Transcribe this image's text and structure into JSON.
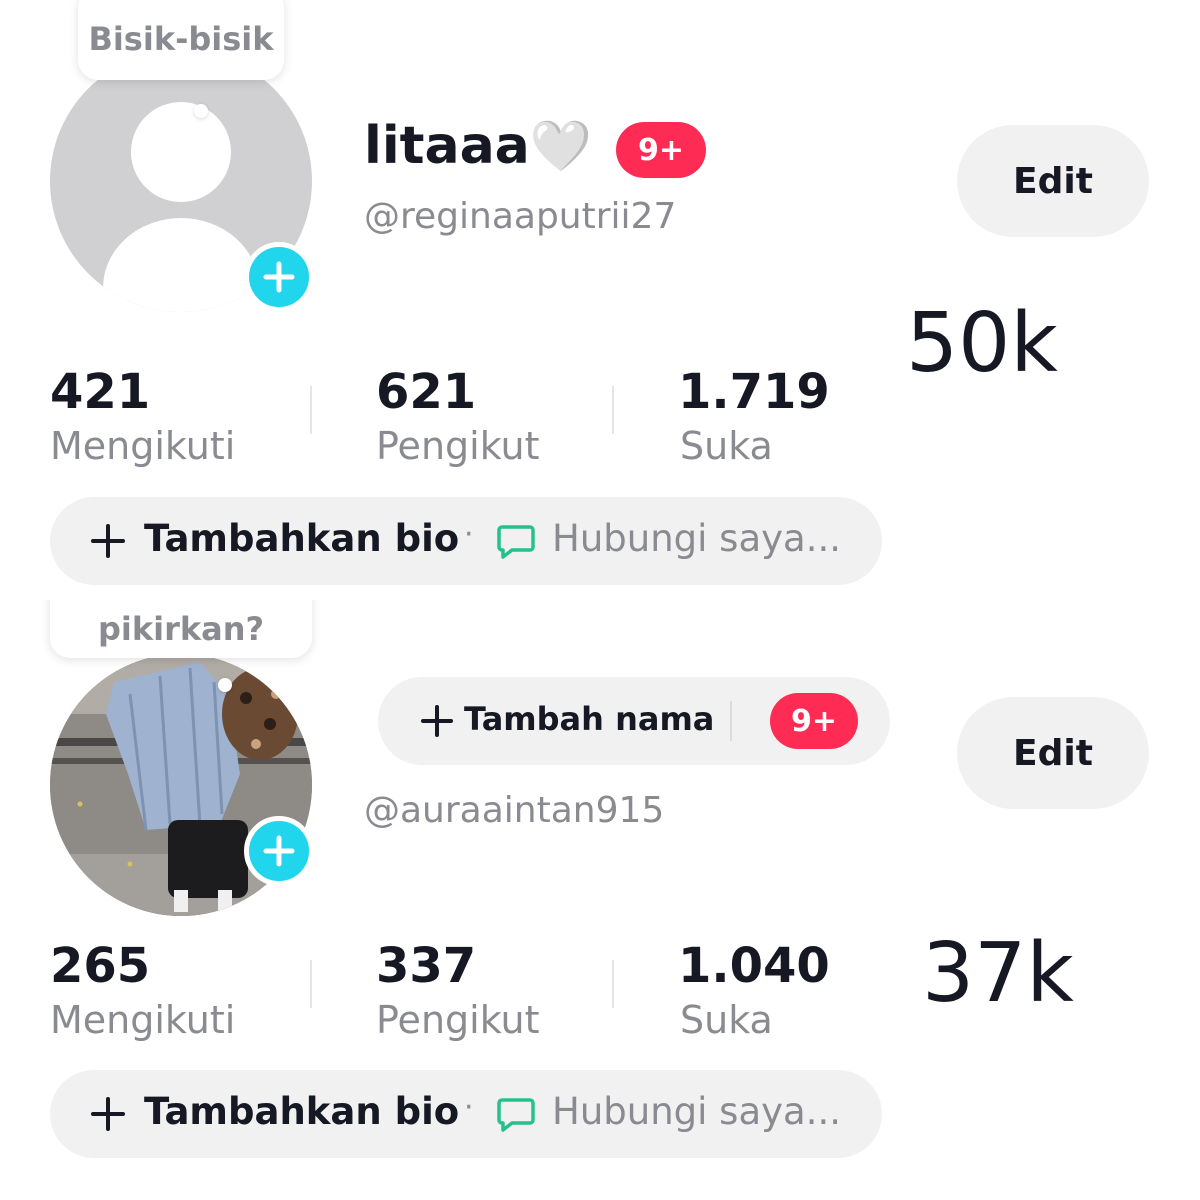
{
  "profile1": {
    "bubble_text": "Bisik-bisik",
    "display_name": "litaaa",
    "name_emoji": "🤍",
    "notification_badge": "9+",
    "username": "@reginaaputrii27",
    "edit_label": "Edit",
    "overlay_count": "50k",
    "stats": [
      {
        "value": "421",
        "label": "Mengikuti"
      },
      {
        "value": "621",
        "label": "Pengikut"
      },
      {
        "value": "1.719",
        "label": "Suka"
      }
    ],
    "bio_add_label": "Tambahkan bio",
    "separator": "·",
    "contact_label": "Hubungi saya..."
  },
  "profile2": {
    "bubble_text": "pikirkan?",
    "add_name_label": "Tambah nama",
    "notification_badge": "9+",
    "username": "@auraaintan915",
    "edit_label": "Edit",
    "overlay_count": "37k",
    "stats": [
      {
        "value": "265",
        "label": "Mengikuti"
      },
      {
        "value": "337",
        "label": "Pengikut"
      },
      {
        "value": "1.040",
        "label": "Suka"
      }
    ],
    "bio_add_label": "Tambahkan bio",
    "separator": "·",
    "contact_label": "Hubungi saya..."
  },
  "colors": {
    "accent_cyan": "#20d5ec",
    "badge_red": "#fe2c55",
    "text_primary": "#161823",
    "text_secondary": "#8a8b91",
    "pill_bg": "#f1f1f2",
    "chat_icon_green": "#25c18b"
  },
  "icons": [
    "plus-icon",
    "chat-bubble-icon",
    "default-avatar-icon"
  ]
}
